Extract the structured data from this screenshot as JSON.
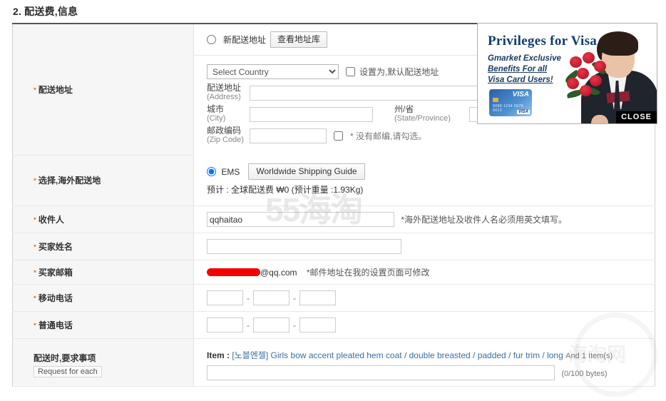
{
  "section": {
    "title": "2. 配送费,信息"
  },
  "rows": {
    "shipping_address": {
      "label": "配送地址",
      "new_address_radio_label": "新配送地址",
      "view_address_book_button": "查看地址库",
      "country_select": {
        "selected": "Select Country",
        "options": [
          "Select Country"
        ]
      },
      "default_address_checkbox_label": "设置为,默认配送地址",
      "address_label_cn": "配送地址",
      "address_label_en": "(Address)",
      "address_value": "",
      "city_label_cn": "城市",
      "city_label_en": "(City)",
      "city_value": "",
      "state_label_cn": "州/省",
      "state_label_en": "(State/Province)",
      "state_value": "",
      "zip_label_cn": "邮政编码",
      "zip_label_en": "(Zip Code)",
      "zip_value": "",
      "no_zip_note": "* 没有邮编,请勾选。"
    },
    "overseas_shipping": {
      "label": "选择,海外配送地",
      "ems_radio_label": "EMS",
      "guide_button": "Worldwide Shipping Guide",
      "estimate_text": "预计 : 全球配送费 ₩0 (预计重量 :1.93Kg)"
    },
    "recipient": {
      "label": "收件人",
      "value": "qqhaitao",
      "note": "*海外配送地址及收件人名必须用英文填写。"
    },
    "buyer_name": {
      "label": "买家姓名",
      "value": ""
    },
    "buyer_email": {
      "label": "买家邮箱",
      "masked_value": "",
      "domain": "@qq.com",
      "note": "*邮件地址在我的设置页面可修改"
    },
    "mobile_phone": {
      "label": "移动电话",
      "part1": "",
      "part2": "",
      "part3": "",
      "separator": "-"
    },
    "landline_phone": {
      "label": "普通电话",
      "part1": "",
      "part2": "",
      "part3": "",
      "separator": "-"
    },
    "delivery_request": {
      "label": "配送时,要求事项",
      "sub_label": "Request for each",
      "item_prefix": "Item :",
      "item_name": "[노블엔젤] Girls bow accent pleated hem coat / double breasted / padded / fur trim / long",
      "item_more": "And 1 Item(s)",
      "request_value": "",
      "byte_counter": "(0/100 bytes)"
    }
  },
  "ad_banner": {
    "title": "Privileges for Visa",
    "line1": "Gmarket Exclusive",
    "line2": "Benefits For all",
    "line3": "Visa Card Users!",
    "card_brand": "VISA",
    "card_digits": "9088 1234 5678 9012",
    "card_badge": "VISA",
    "close_label": "CLOSE"
  },
  "watermarks": {
    "primary": "55海淘",
    "secondary": "海淘网"
  },
  "colors": {
    "accent_required": "#e8893c",
    "link": "#3a6ea5",
    "ad_title": "#123c72",
    "masked": "#f40000"
  }
}
